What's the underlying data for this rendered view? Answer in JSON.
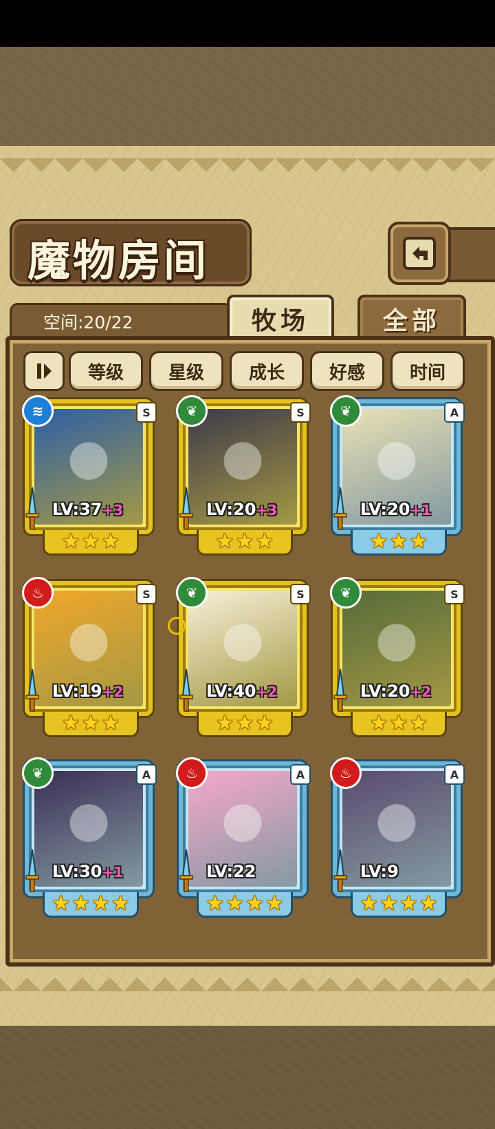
{
  "header": {
    "title": "魔物房间",
    "back_icon": "return-arrow-icon"
  },
  "capacity": {
    "label": "空间:20/22"
  },
  "tabs": [
    {
      "label": "牧场",
      "active": true
    },
    {
      "label": "全部",
      "active": false
    }
  ],
  "sort": {
    "toggle_icon": "pause-sort-toggle-icon",
    "buttons": [
      "等级",
      "星级",
      "成长",
      "好感",
      "时间"
    ]
  },
  "monsters": [
    {
      "level": "LV:37",
      "bonus": "+3",
      "rank": "S",
      "element": "water",
      "stars": 3,
      "frame": "gold",
      "color": "#2c5fa8"
    },
    {
      "level": "LV:20",
      "bonus": "+3",
      "rank": "S",
      "element": "leaf",
      "stars": 3,
      "frame": "gold",
      "color": "#3d3a4a"
    },
    {
      "level": "LV:20",
      "bonus": "+1",
      "rank": "A",
      "element": "leaf",
      "stars": 3,
      "frame": "blue",
      "color": "#e8e0b4"
    },
    {
      "level": "LV:19",
      "bonus": "+2",
      "rank": "S",
      "element": "fire",
      "stars": 3,
      "frame": "gold",
      "color": "#f0a62a"
    },
    {
      "level": "LV:40",
      "bonus": "+2",
      "rank": "S",
      "element": "leaf",
      "stars": 3,
      "frame": "gold",
      "color": "#f6efd8"
    },
    {
      "level": "LV:20",
      "bonus": "+2",
      "rank": "S",
      "element": "leaf",
      "stars": 3,
      "frame": "gold",
      "color": "#556b3a"
    },
    {
      "level": "LV:30",
      "bonus": "+1",
      "rank": "A",
      "element": "leaf",
      "stars": 4,
      "frame": "blue",
      "color": "#3a2f55"
    },
    {
      "level": "LV:22",
      "bonus": "",
      "rank": "A",
      "element": "fire",
      "stars": 4,
      "frame": "blue",
      "color": "#f6a7c8"
    },
    {
      "level": "LV:9",
      "bonus": "",
      "rank": "A",
      "element": "fire",
      "stars": 4,
      "frame": "blue",
      "color": "#5a4a6e"
    }
  ]
}
